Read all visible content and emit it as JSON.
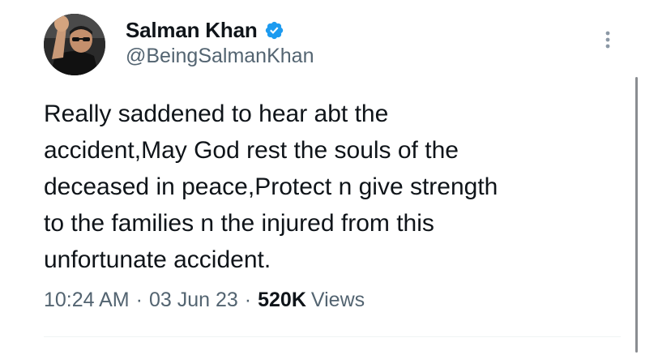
{
  "author": {
    "display_name": "Salman Khan",
    "handle": "@BeingSalmanKhan",
    "verified": true,
    "verified_color": "#1d9bf0"
  },
  "tweet": {
    "text": "Really saddened to hear abt the\naccident,May God rest the souls of the\ndeceased in peace,Protect n give strength\nto the families n the injured from this\nunfortunate accident.",
    "time": "10:24 AM",
    "separator": "·",
    "date": "03 Jun 23",
    "views_count": "520K",
    "views_label": "Views"
  },
  "icons": {
    "avatar": "profile-photo",
    "verified": "verified-badge-icon",
    "more": "more-options-icon"
  }
}
